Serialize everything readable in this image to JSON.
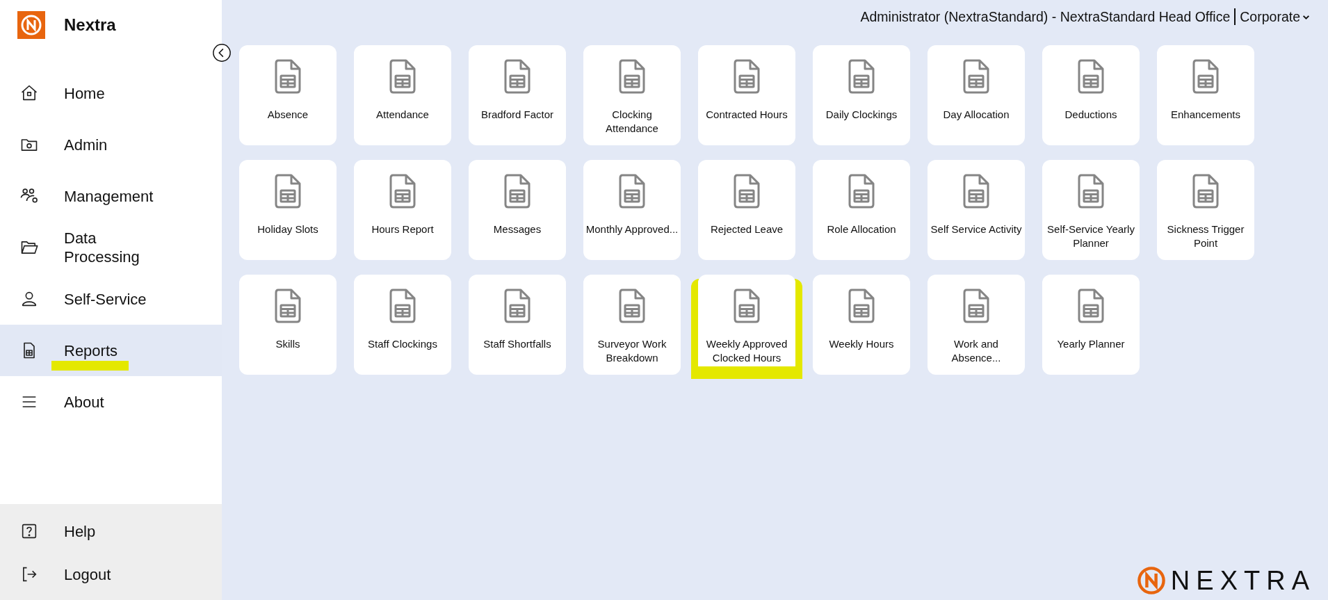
{
  "brand": {
    "name": "Nextra",
    "footer_logo": "NEXTRA"
  },
  "header": {
    "user": "Administrator (NextraStandard) - NextraStandard Head Office",
    "context": "Corporate"
  },
  "sidebar": {
    "items": [
      {
        "label": "Home",
        "selected": false,
        "highlighted": false
      },
      {
        "label": "Admin",
        "selected": false,
        "highlighted": false
      },
      {
        "label": "Management",
        "selected": false,
        "highlighted": false
      },
      {
        "label": "Data Processing",
        "selected": false,
        "highlighted": false
      },
      {
        "label": "Self-Service",
        "selected": false,
        "highlighted": false
      },
      {
        "label": "Reports",
        "selected": true,
        "highlighted": true
      },
      {
        "label": "About",
        "selected": false,
        "highlighted": false
      }
    ],
    "footer_items": [
      {
        "label": "Help"
      },
      {
        "label": "Logout"
      }
    ]
  },
  "reports": [
    {
      "label": "Absence",
      "highlighted": false
    },
    {
      "label": "Attendance",
      "highlighted": false
    },
    {
      "label": "Bradford Factor",
      "highlighted": false
    },
    {
      "label": "Clocking Attendance",
      "highlighted": false
    },
    {
      "label": "Contracted Hours",
      "highlighted": false
    },
    {
      "label": "Daily Clockings",
      "highlighted": false
    },
    {
      "label": "Day Allocation",
      "highlighted": false
    },
    {
      "label": "Deductions",
      "highlighted": false
    },
    {
      "label": "Enhancements",
      "highlighted": false
    },
    {
      "label": "Holiday Slots",
      "highlighted": false
    },
    {
      "label": "Hours Report",
      "highlighted": false
    },
    {
      "label": "Messages",
      "highlighted": false
    },
    {
      "label": "Monthly Approved...",
      "highlighted": false
    },
    {
      "label": "Rejected Leave",
      "highlighted": false
    },
    {
      "label": "Role Allocation",
      "highlighted": false
    },
    {
      "label": "Self Service Activity",
      "highlighted": false
    },
    {
      "label": "Self-Service Yearly Planner",
      "highlighted": false
    },
    {
      "label": "Sickness Trigger Point",
      "highlighted": false
    },
    {
      "label": "Skills",
      "highlighted": false
    },
    {
      "label": "Staff Clockings",
      "highlighted": false
    },
    {
      "label": "Staff Shortfalls",
      "highlighted": false
    },
    {
      "label": "Surveyor Work Breakdown",
      "highlighted": false
    },
    {
      "label": "Weekly Approved Clocked Hours",
      "highlighted": true
    },
    {
      "label": "Weekly Hours",
      "highlighted": false
    },
    {
      "label": "Work and Absence...",
      "highlighted": false
    },
    {
      "label": "Yearly Planner",
      "highlighted": false
    }
  ]
}
